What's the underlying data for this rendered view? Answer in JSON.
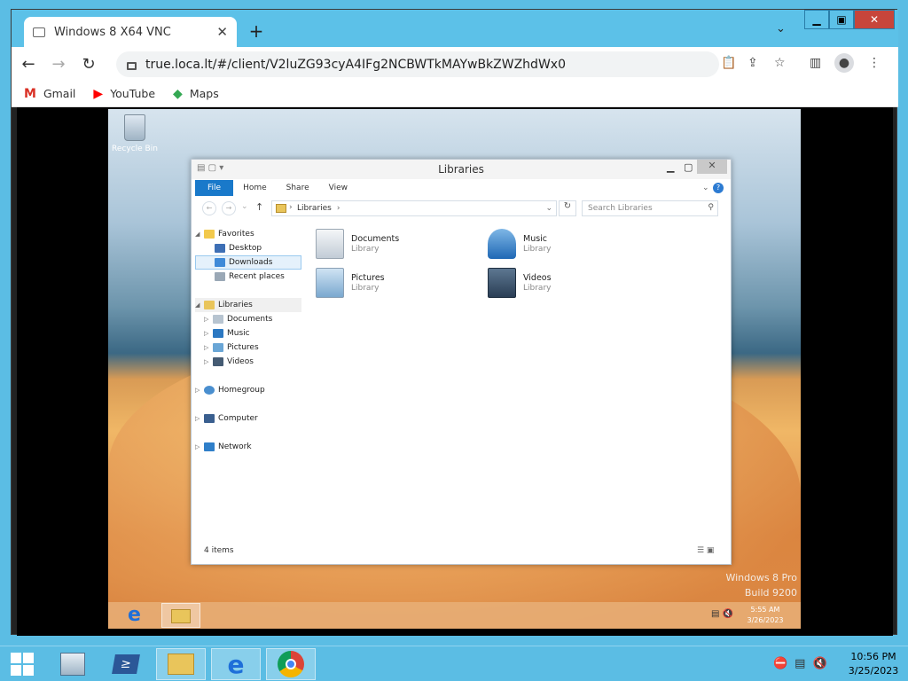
{
  "browser": {
    "tab_title": "Windows 8 X64 VNC",
    "url": "true.loca.lt/#/client/V2luZG93cyA4IFg2NCBWTkMAYwBkZWZhdWx0",
    "bookmarks": [
      {
        "label": "Gmail",
        "icon": "gmail-icon",
        "color": "#d93025"
      },
      {
        "label": "YouTube",
        "icon": "youtube-icon",
        "color": "#ff0000"
      },
      {
        "label": "Maps",
        "icon": "maps-icon",
        "color": "#34a853"
      }
    ]
  },
  "remote": {
    "desktop": {
      "recycle_bin_label": "Recycle Bin",
      "watermark_line1": "Windows 8 Pro",
      "watermark_line2": "Build 9200"
    },
    "explorer": {
      "title": "Libraries",
      "ribbon_tabs": [
        "File",
        "Home",
        "Share",
        "View"
      ],
      "breadcrumb": "Libraries",
      "search_placeholder": "Search Libraries",
      "nav": {
        "favorites": "Favorites",
        "desktop": "Desktop",
        "downloads": "Downloads",
        "recent": "Recent places",
        "libraries": "Libraries",
        "documents": "Documents",
        "music": "Music",
        "pictures": "Pictures",
        "videos": "Videos",
        "homegroup": "Homegroup",
        "computer": "Computer",
        "network": "Network"
      },
      "items": [
        {
          "name": "Documents",
          "type": "Library"
        },
        {
          "name": "Music",
          "type": "Library"
        },
        {
          "name": "Pictures",
          "type": "Library"
        },
        {
          "name": "Videos",
          "type": "Library"
        }
      ],
      "status": "4 items"
    },
    "taskbar": {
      "time": "5:55 AM",
      "date": "3/26/2023"
    }
  },
  "host_taskbar": {
    "time": "10:56 PM",
    "date": "3/25/2023"
  }
}
